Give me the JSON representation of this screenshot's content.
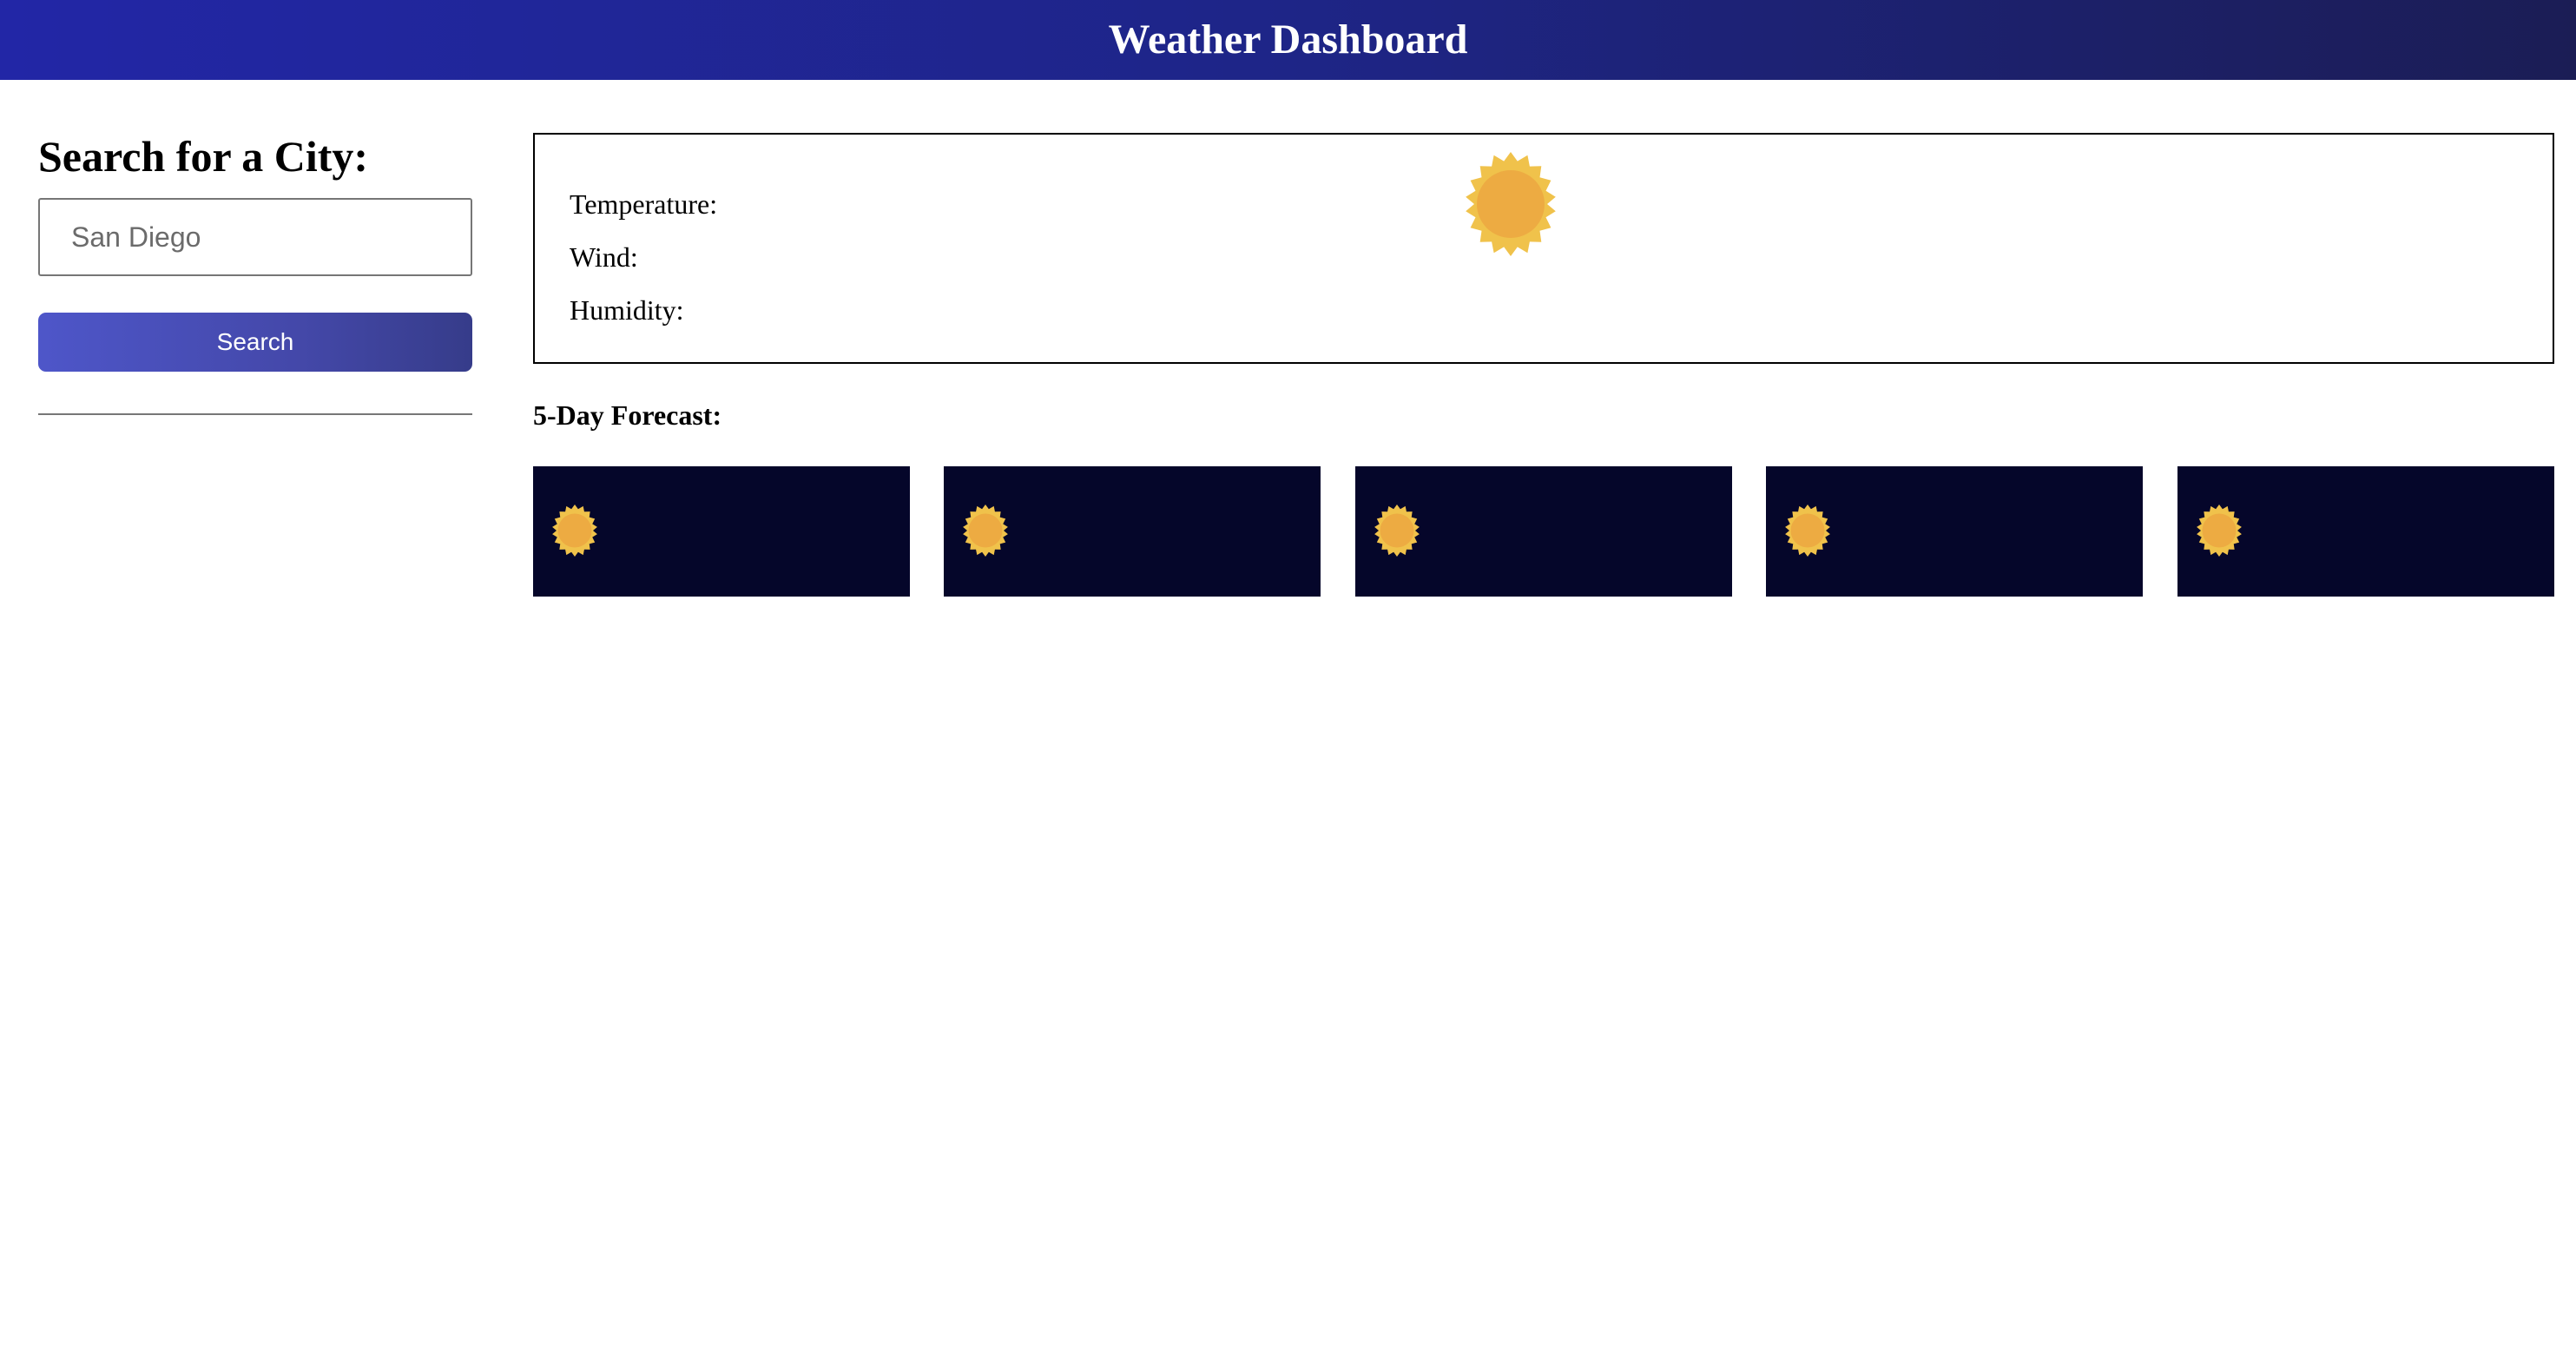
{
  "app": {
    "title": "Weather Dashboard"
  },
  "sidebar": {
    "heading": "Search for a City:",
    "search_input": {
      "value": "",
      "placeholder": "San Diego"
    },
    "search_button_label": "Search"
  },
  "current_weather": {
    "temperature_label": "Temperature:",
    "wind_label": "Wind:",
    "humidity_label": "Humidity:",
    "icon": "sun-icon"
  },
  "forecast": {
    "title": "5-Day Forecast:",
    "days": [
      {
        "icon": "sun-icon"
      },
      {
        "icon": "sun-icon"
      },
      {
        "icon": "sun-icon"
      },
      {
        "icon": "sun-icon"
      },
      {
        "icon": "sun-icon"
      }
    ]
  },
  "colors": {
    "header_gradient_start": "#2226a6",
    "header_gradient_end": "#1b1d55",
    "button_gradient_start": "#4e56c9",
    "button_gradient_end": "#363c8a",
    "forecast_card_bg": "#05062a",
    "sun_outer": "#f0c24b",
    "sun_inner": "#edab42"
  }
}
